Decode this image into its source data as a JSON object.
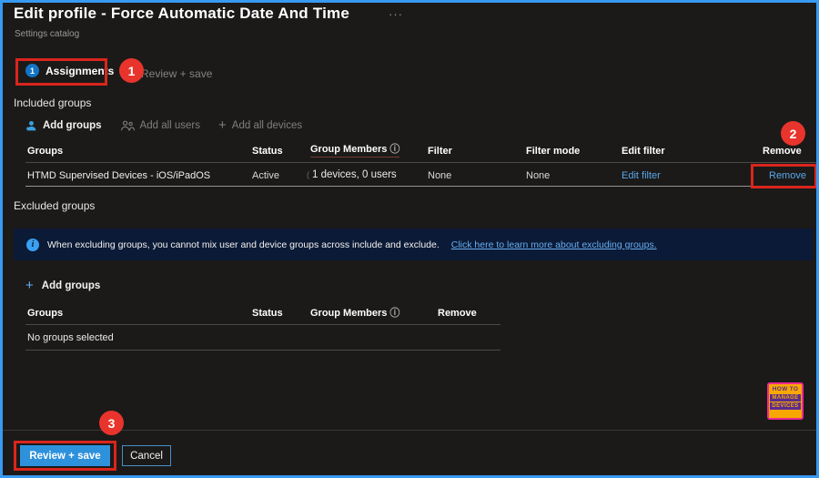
{
  "window": {
    "title": "Edit profile - Force Automatic Date And Time",
    "subtitle": "Settings catalog",
    "more_label": "···"
  },
  "tabs": {
    "assignments": {
      "step": "1",
      "label": "Assignments"
    },
    "review_save": {
      "label": "Review + save"
    }
  },
  "annotations": {
    "step1": "1",
    "step2": "2",
    "step3": "3"
  },
  "included_groups": {
    "heading": "Included groups",
    "toolbar": {
      "add_groups": "Add groups",
      "add_all_users": "Add all users",
      "add_all_devices": "Add all devices"
    },
    "table": {
      "headers": {
        "groups": "Groups",
        "status": "Status",
        "group_members": "Group Members",
        "filter": "Filter",
        "filter_mode": "Filter mode",
        "edit_filter": "Edit filter",
        "remove": "Remove"
      },
      "row": {
        "group": "HTMD Supervised Devices - iOS/iPadOS",
        "status": "Active",
        "members": "1 devices, 0 users",
        "filter": "None",
        "filter_mode": "None",
        "edit_filter": "Edit filter",
        "remove": "Remove"
      }
    }
  },
  "excluded_groups": {
    "heading": "Excluded groups",
    "banner": {
      "text": "When excluding groups, you cannot mix user and device groups across include and exclude.",
      "link": "Click here to learn more about excluding groups."
    },
    "add_groups": "Add groups",
    "table": {
      "headers": {
        "groups": "Groups",
        "status": "Status",
        "group_members": "Group Members",
        "remove": "Remove"
      },
      "empty": "No groups selected"
    }
  },
  "footer": {
    "review_save": "Review + save",
    "cancel": "Cancel"
  },
  "watermark": {
    "line1": "HOW TO",
    "line2": "MANAGE",
    "line3": "DEVICES"
  },
  "colors": {
    "frame_border": "#389af2",
    "background": "#1b1a19",
    "primary_button": "#2d91dc",
    "link_blue": "#5aa7ea",
    "annotation_red": "#e8342c",
    "banner_bg": "#0b1a36",
    "step_circle_blue": "#1374c6",
    "logo_pink": "#ee2a92",
    "logo_orange": "#f7a800",
    "logo_purple": "#5b2b8e"
  }
}
